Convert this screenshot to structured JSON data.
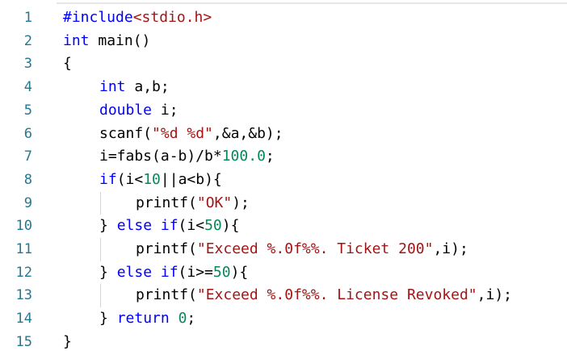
{
  "editor": {
    "line_numbers": [
      "1",
      "2",
      "3",
      "4",
      "5",
      "6",
      "7",
      "8",
      "9",
      "10",
      "11",
      "12",
      "13",
      "14",
      "15"
    ],
    "lines": [
      {
        "indent": 0,
        "tokens": [
          {
            "t": "#include",
            "c": "kw"
          },
          {
            "t": "<stdio.h>",
            "c": "str"
          }
        ]
      },
      {
        "indent": 0,
        "tokens": [
          {
            "t": "int",
            "c": "kw"
          },
          {
            "t": " main()",
            "c": "txt"
          }
        ]
      },
      {
        "indent": 0,
        "tokens": [
          {
            "t": "{",
            "c": "txt"
          }
        ]
      },
      {
        "indent": 1,
        "tokens": [
          {
            "t": "int",
            "c": "kw"
          },
          {
            "t": " a,b;",
            "c": "txt"
          }
        ]
      },
      {
        "indent": 1,
        "tokens": [
          {
            "t": "double",
            "c": "kw"
          },
          {
            "t": " i;",
            "c": "txt"
          }
        ]
      },
      {
        "indent": 1,
        "tokens": [
          {
            "t": "scanf(",
            "c": "txt"
          },
          {
            "t": "\"%d %d\"",
            "c": "str"
          },
          {
            "t": ",&a,&b);",
            "c": "txt"
          }
        ]
      },
      {
        "indent": 1,
        "tokens": [
          {
            "t": "i=fabs(a-b)/b*",
            "c": "txt"
          },
          {
            "t": "100.0",
            "c": "num"
          },
          {
            "t": ";",
            "c": "txt"
          }
        ]
      },
      {
        "indent": 1,
        "tokens": [
          {
            "t": "if",
            "c": "kw"
          },
          {
            "t": "(i<",
            "c": "txt"
          },
          {
            "t": "10",
            "c": "num"
          },
          {
            "t": "||a<b){",
            "c": "txt"
          }
        ]
      },
      {
        "indent": 2,
        "tokens": [
          {
            "t": "printf(",
            "c": "txt"
          },
          {
            "t": "\"OK\"",
            "c": "str"
          },
          {
            "t": ");",
            "c": "txt"
          }
        ]
      },
      {
        "indent": 1,
        "tokens": [
          {
            "t": "} ",
            "c": "txt"
          },
          {
            "t": "else if",
            "c": "kw"
          },
          {
            "t": "(i<",
            "c": "txt"
          },
          {
            "t": "50",
            "c": "num"
          },
          {
            "t": "){",
            "c": "txt"
          }
        ]
      },
      {
        "indent": 2,
        "tokens": [
          {
            "t": "printf(",
            "c": "txt"
          },
          {
            "t": "\"Exceed %.0f%%. Ticket 200\"",
            "c": "str"
          },
          {
            "t": ",i);",
            "c": "txt"
          }
        ]
      },
      {
        "indent": 1,
        "tokens": [
          {
            "t": "} ",
            "c": "txt"
          },
          {
            "t": "else if",
            "c": "kw"
          },
          {
            "t": "(i>=",
            "c": "txt"
          },
          {
            "t": "50",
            "c": "num"
          },
          {
            "t": "){",
            "c": "txt"
          }
        ]
      },
      {
        "indent": 2,
        "tokens": [
          {
            "t": "printf(",
            "c": "txt"
          },
          {
            "t": "\"Exceed %.0f%%. License Revoked\"",
            "c": "str"
          },
          {
            "t": ",i);",
            "c": "txt"
          }
        ]
      },
      {
        "indent": 1,
        "tokens": [
          {
            "t": "} ",
            "c": "txt"
          },
          {
            "t": "return",
            "c": "kw"
          },
          {
            "t": " ",
            "c": "txt"
          },
          {
            "t": "0",
            "c": "num"
          },
          {
            "t": ";",
            "c": "txt"
          }
        ]
      },
      {
        "indent": 0,
        "tokens": [
          {
            "t": "}",
            "c": "txt"
          }
        ]
      }
    ]
  }
}
